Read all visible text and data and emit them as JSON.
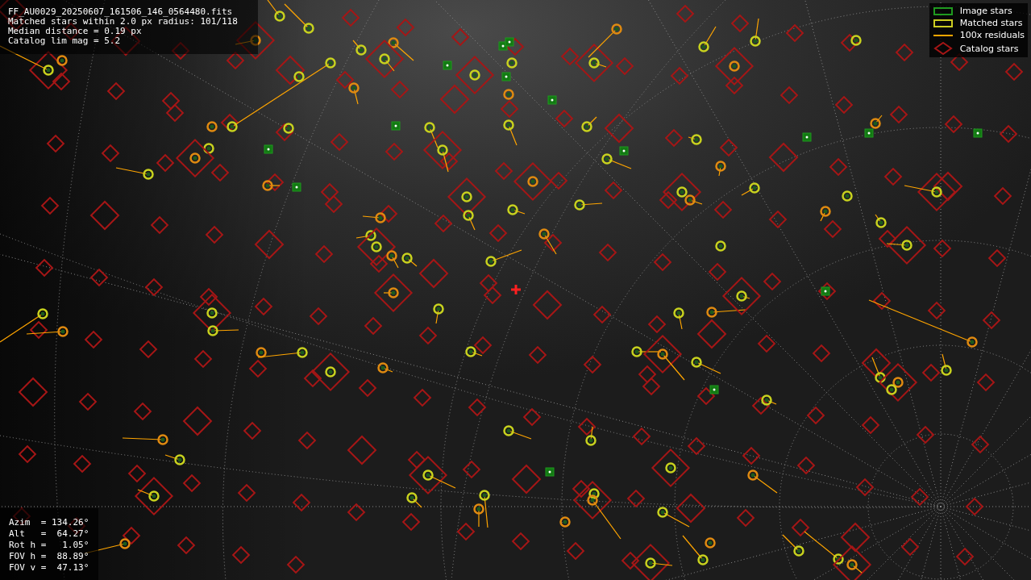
{
  "info": {
    "lines": [
      "FF_AU0029_20250607_161506_146_0564480.fits",
      "Matched stars within 2.0 px radius: 101/118",
      "Median distance = 0.19 px",
      "Catalog lim mag = 5.2"
    ]
  },
  "legend": [
    {
      "label": "Image stars",
      "kind": "box",
      "color": "#1f9a1f"
    },
    {
      "label": "Matched stars",
      "kind": "box",
      "color": "#cccc22"
    },
    {
      "label": "100x residuals",
      "kind": "line",
      "color": "#ffa500"
    },
    {
      "label": "Catalog stars",
      "kind": "diamond",
      "color": "#a51616"
    }
  ],
  "pointing": {
    "lines": [
      "Azim  = 134.26°",
      "Alt   =  64.27°",
      "Rot h =   1.05°",
      "FOV h =  88.89°",
      "FOV v =  47.13°"
    ]
  }
}
